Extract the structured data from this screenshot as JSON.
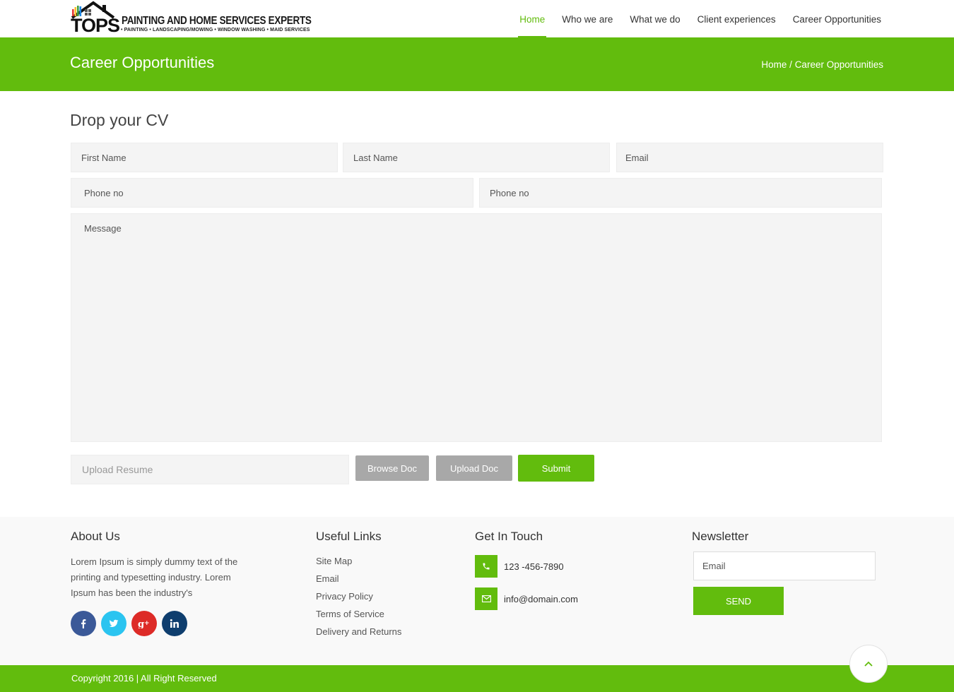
{
  "header": {
    "logo": {
      "brand": "TOPS",
      "tagline": "PAINTING AND HOME SERVICES EXPERTS",
      "services": "• PAINTING  •  LANDSCAPING/MOWING  •  WINDOW WASHING  •  MAID SERVICES"
    },
    "nav": [
      {
        "label": "Home",
        "active": true
      },
      {
        "label": "Who we are"
      },
      {
        "label": "What we do"
      },
      {
        "label": "Client experiences"
      },
      {
        "label": "Career Opportunities"
      }
    ]
  },
  "banner": {
    "title": "Career Opportunities",
    "breadcrumb_home": "Home",
    "breadcrumb_sep": " / ",
    "breadcrumb_current": "Career Opportunities"
  },
  "form": {
    "heading": "Drop your CV",
    "first_name_placeholder": "First Name",
    "last_name_placeholder": "Last Name",
    "email_placeholder": "Email",
    "phone1_placeholder": "Phone no",
    "phone2_placeholder": "Phone no",
    "message_placeholder": "Message",
    "resume_placeholder": "Upload Resume",
    "browse_label": "Browse Doc",
    "upload_label": "Upload Doc",
    "submit_label": "Submit"
  },
  "footer": {
    "about": {
      "heading": "About Us",
      "text": "Lorem Ipsum is simply dummy text of the printing and typesetting industry. Lorem Ipsum has been the industry's"
    },
    "socials": [
      "facebook-icon",
      "twitter-icon",
      "google-plus-icon",
      "linkedin-icon"
    ],
    "links": {
      "heading": "Useful Links",
      "items": [
        "Site Map",
        "Email",
        "Privacy Policy",
        "Terms of Service",
        "Delivery and Returns"
      ]
    },
    "contact": {
      "heading": "Get In Touch",
      "phone": "123 -456-7890",
      "email": "info@domain.com"
    },
    "newsletter": {
      "heading": "Newsletter",
      "email_placeholder": "Email",
      "send_label": "SEND"
    },
    "copyright": "Copyright 2016 | All Right Reserved"
  },
  "colors": {
    "accent": "#62bc0d",
    "button_gray": "#a8a8a8",
    "facebook": "#3b5998",
    "twitter": "#2bc4f0",
    "google_plus": "#dd2b27",
    "linkedin": "#0f3e6e"
  }
}
